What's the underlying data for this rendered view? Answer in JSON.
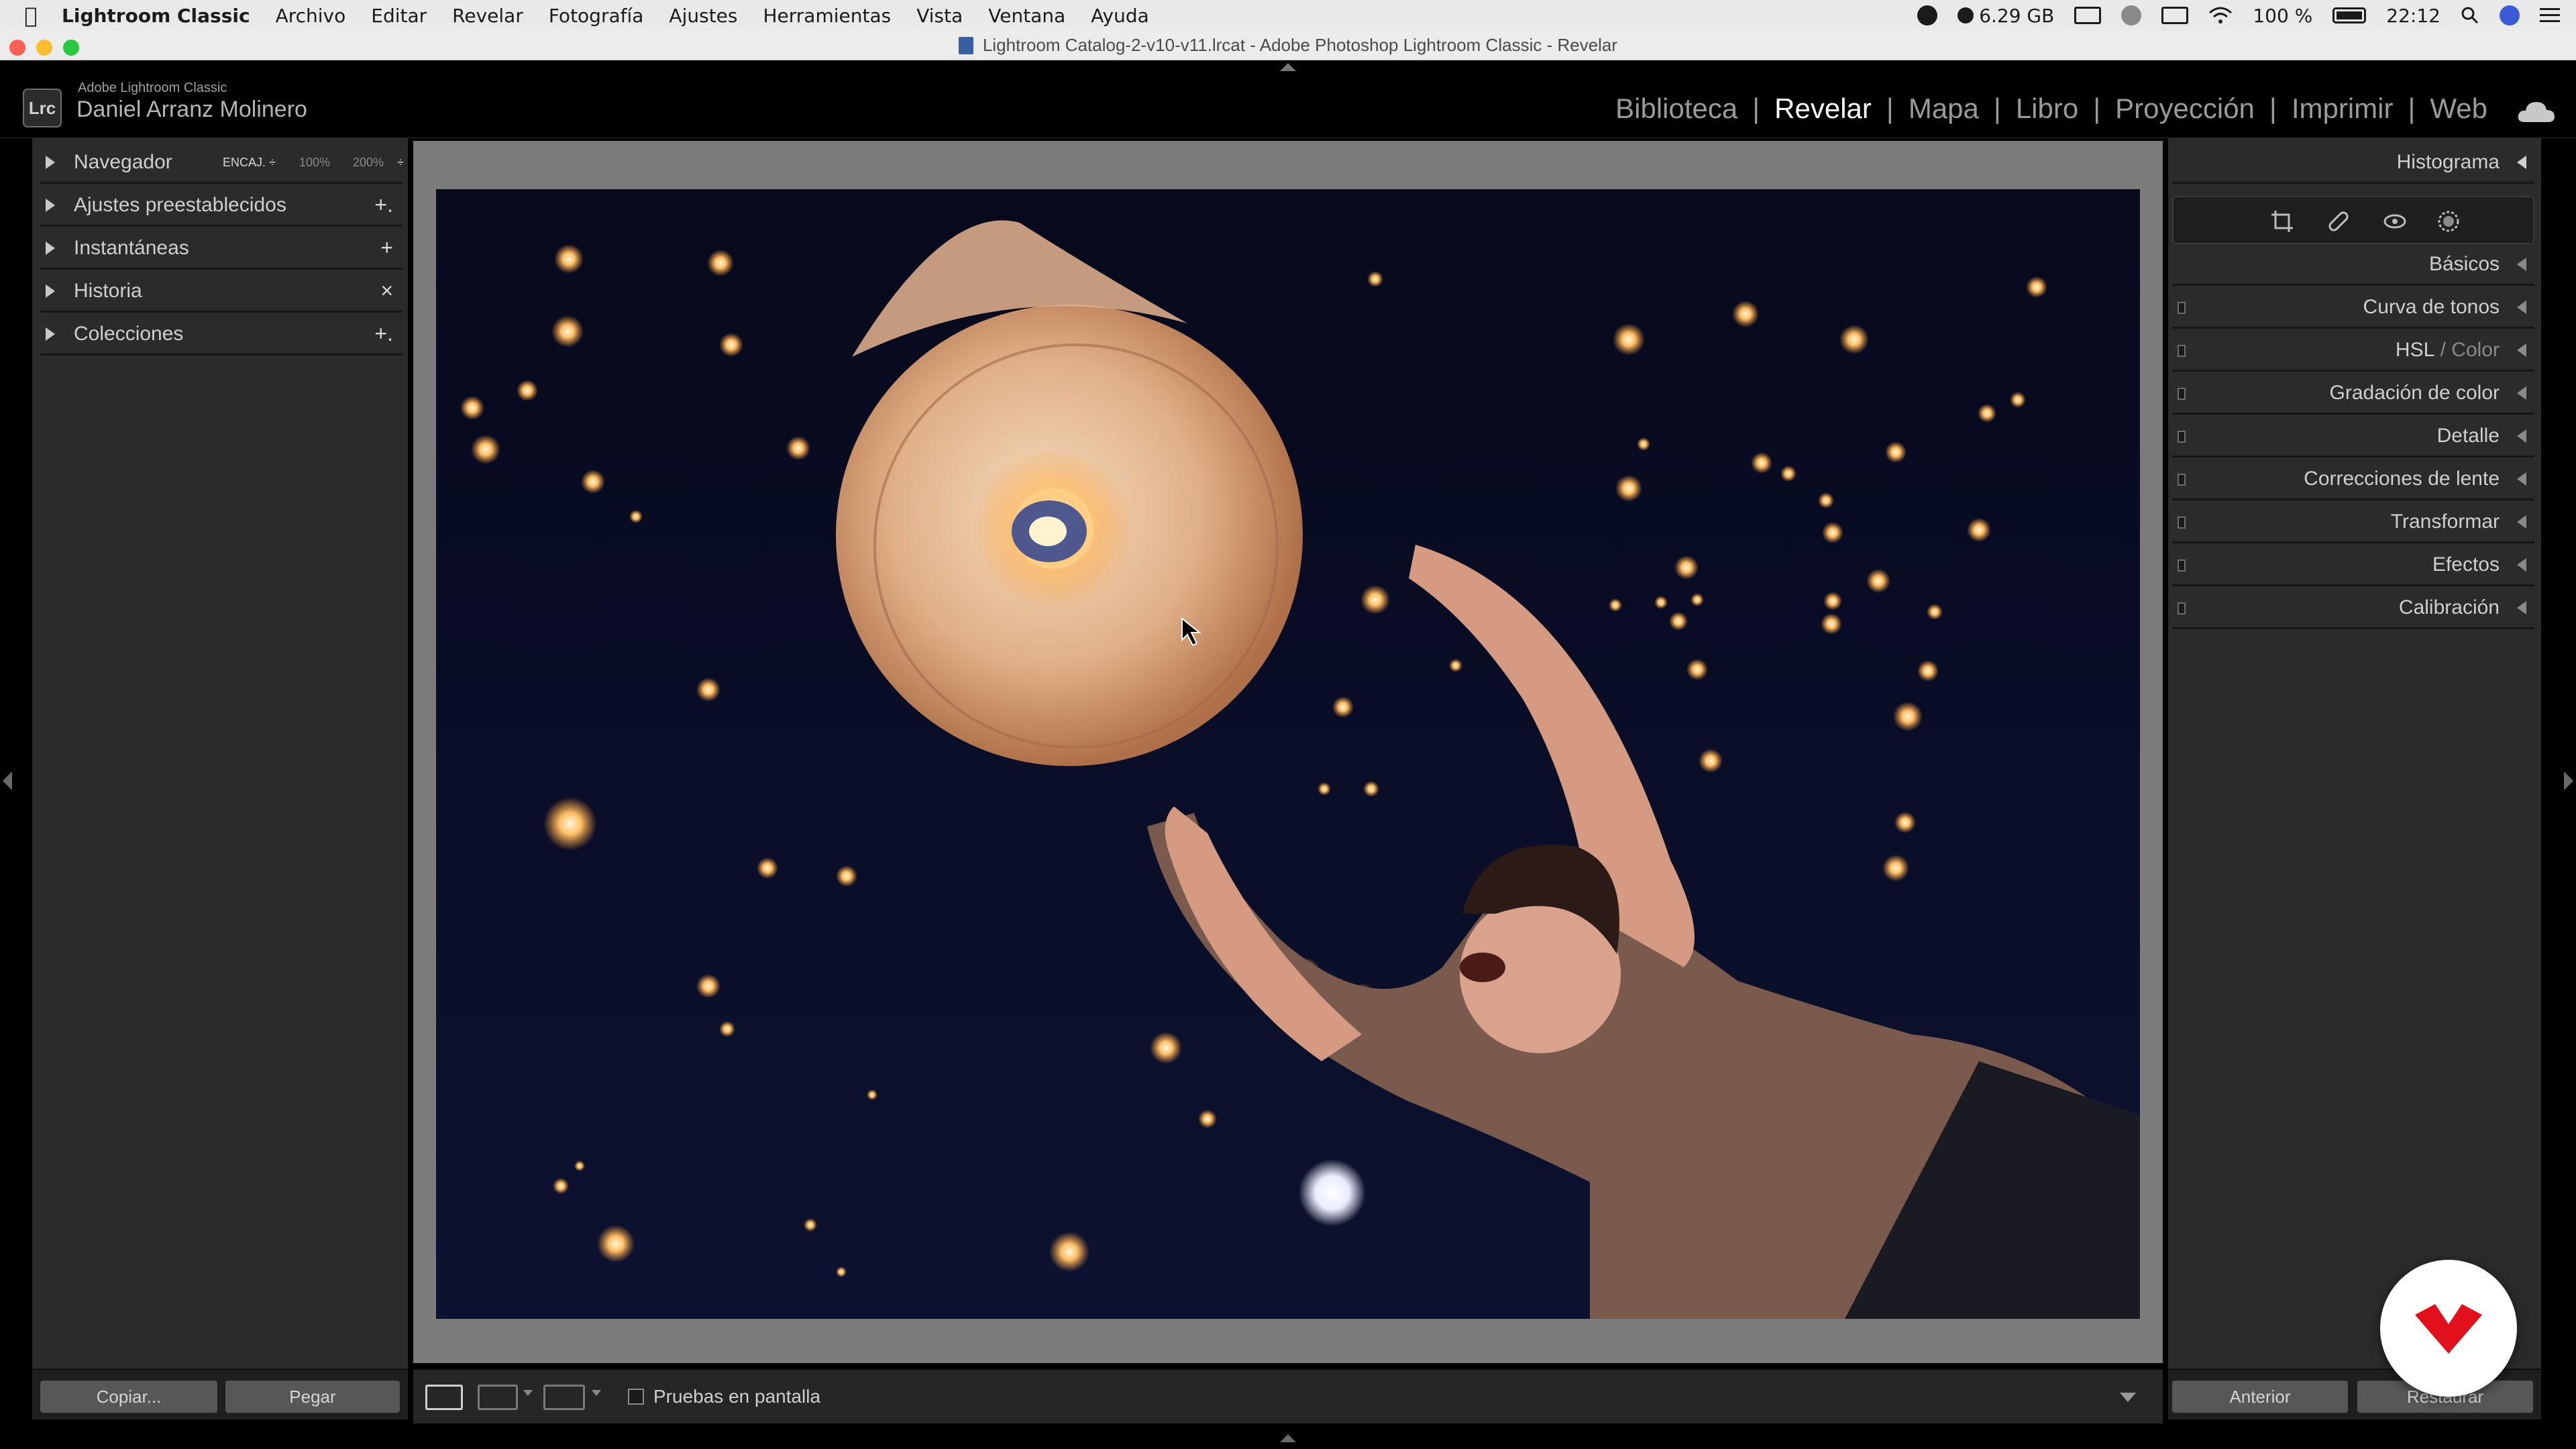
{
  "menubar": {
    "app_name": "Lightroom Classic",
    "menus": [
      "Archivo",
      "Editar",
      "Revelar",
      "Fotografía",
      "Ajustes",
      "Herramientas",
      "Vista",
      "Ventana",
      "Ayuda"
    ],
    "memory": "6.29 GB",
    "battery": "100 %",
    "clock": "22:12"
  },
  "window": {
    "title": "Lightroom Catalog-2-v10-v11.lrcat - Adobe Photoshop Lightroom Classic - Revelar"
  },
  "identity": {
    "badge": "Lrc",
    "product": "Adobe Lightroom Classic",
    "user": "Daniel Arranz Molinero"
  },
  "modules": {
    "items": [
      "Biblioteca",
      "Revelar",
      "Mapa",
      "Libro",
      "Proyección",
      "Imprimir",
      "Web"
    ],
    "active": "Revelar"
  },
  "left_panel": {
    "navigator": {
      "label": "Navegador",
      "zoom_fit": "ENCAJ. ÷",
      "zoom_100": "100%",
      "zoom_200": "200%",
      "zoom_more": "÷"
    },
    "sections": [
      {
        "label": "Ajustes preestablecidos",
        "action": "+."
      },
      {
        "label": "Instantáneas",
        "action": "+"
      },
      {
        "label": "Historia",
        "action": "×"
      },
      {
        "label": "Colecciones",
        "action": "+."
      }
    ],
    "copy_button": "Copiar...",
    "paste_button": "Pegar"
  },
  "toolbar": {
    "soft_proof_label": "Pruebas en pantalla",
    "soft_proof_checked": false
  },
  "right_panel": {
    "histogram_label": "Histograma",
    "panels": [
      {
        "label": "Básicos",
        "toggle": false
      },
      {
        "label": "Curva de tonos",
        "toggle": true
      },
      {
        "label_main": "HSL",
        "label_sep": " / ",
        "label_dim": "Color",
        "toggle": true
      },
      {
        "label": "Gradación de color",
        "toggle": true
      },
      {
        "label": "Detalle",
        "toggle": true
      },
      {
        "label": "Correcciones de lente",
        "toggle": true
      },
      {
        "label": "Transformar",
        "toggle": true
      },
      {
        "label": "Efectos",
        "toggle": true
      },
      {
        "label": "Calibración",
        "toggle": true
      }
    ],
    "previous_button": "Anterior",
    "reset_button": "Restaurar"
  },
  "colors": {
    "accent_red": "#e0101c",
    "panel_bg": "#2b2b2b",
    "workspace_bg": "#7b7b7b"
  }
}
